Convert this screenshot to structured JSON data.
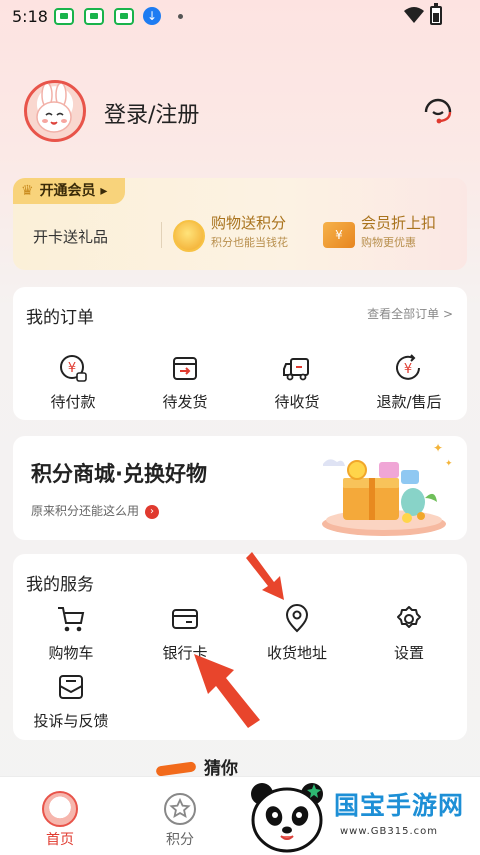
{
  "status_bar": {
    "time": "5:18"
  },
  "header": {
    "login_label": "登录/注册"
  },
  "vip": {
    "badge": "开通会员",
    "gift": "开卡送礼品",
    "items": [
      {
        "title": "购物送积分",
        "sub": "积分也能当钱花"
      },
      {
        "title": "会员折上扣",
        "sub": "购物更优惠"
      }
    ]
  },
  "orders": {
    "title": "我的订单",
    "view_all": "查看全部订单 >",
    "items": [
      {
        "label": "待付款"
      },
      {
        "label": "待发货"
      },
      {
        "label": "待收货"
      },
      {
        "label": "退款/售后"
      }
    ]
  },
  "points_mall": {
    "title": "积分商城·兑换好物",
    "subtitle": "原来积分还能这么用"
  },
  "services": {
    "title": "我的服务",
    "items": [
      {
        "label": "购物车"
      },
      {
        "label": "银行卡"
      },
      {
        "label": "收货地址"
      },
      {
        "label": "设置"
      },
      {
        "label": "投诉与反馈"
      }
    ]
  },
  "promo": {
    "text": "猜你"
  },
  "tabbar": {
    "items": [
      {
        "label": "首页"
      },
      {
        "label": "积分"
      }
    ]
  },
  "watermark": {
    "text": "国宝手游网",
    "url": "www.GB315.com"
  },
  "colors": {
    "accent_red": "#e03a2f",
    "annotation_red": "#e8452c",
    "gold_text": "#a9731d",
    "app_green": "#19b34b",
    "watermark_blue": "#1d8fd6"
  }
}
